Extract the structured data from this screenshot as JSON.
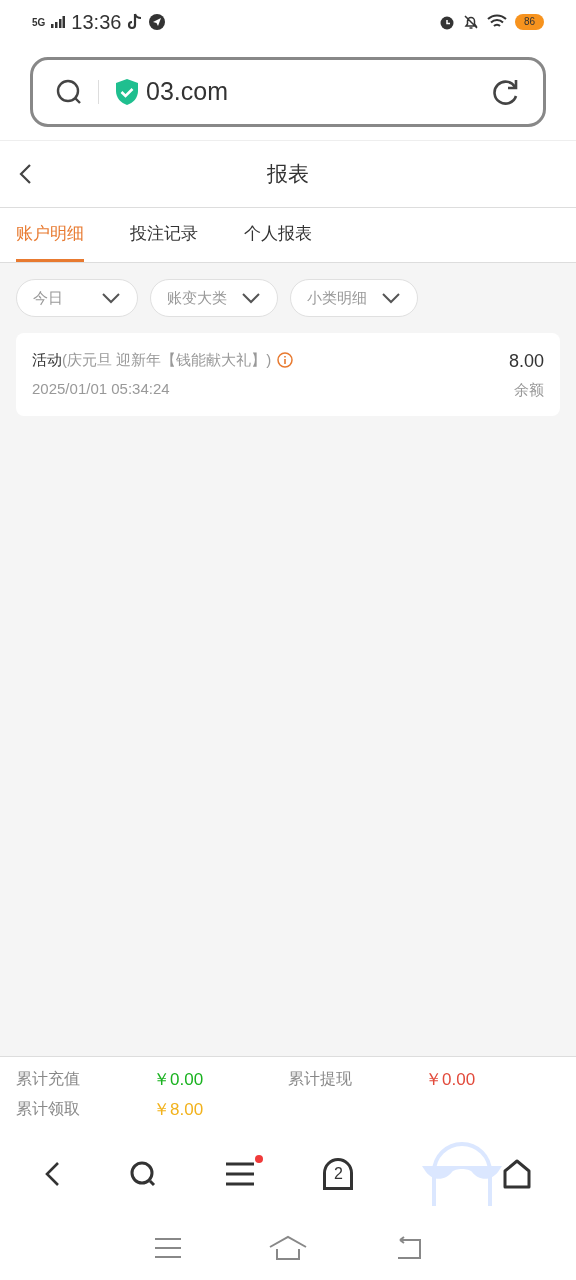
{
  "status_bar": {
    "network": "5G",
    "time": "13:36",
    "battery": "86"
  },
  "address_bar": {
    "url": "03.com"
  },
  "header": {
    "title": "报表"
  },
  "tabs": [
    {
      "label": "账户明细",
      "selected": true
    },
    {
      "label": "投注记录",
      "selected": false
    },
    {
      "label": "个人报表",
      "selected": false
    }
  ],
  "filters": [
    "今日",
    "账变大类",
    "小类明细"
  ],
  "records": [
    {
      "type": "活动",
      "detail": "(庆元旦 迎新年【钱能献大礼】)",
      "time": "2025/01/01 05:34:24",
      "amount": "8.00",
      "amount_label": "余额"
    }
  ],
  "summary": [
    {
      "label": "累计充值",
      "value": "￥0.00",
      "color": "#19b21f"
    },
    {
      "label": "累计提现",
      "value": "￥0.00",
      "color": "#e24a3b"
    },
    {
      "label": "累计领取",
      "value": "￥8.00",
      "color": "#f2b21c"
    }
  ],
  "browser_nav": {
    "tab_count": "2"
  }
}
